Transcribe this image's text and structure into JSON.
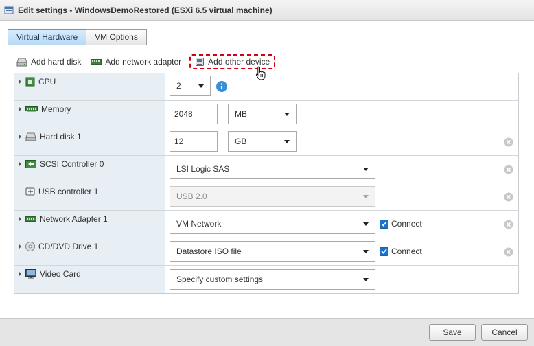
{
  "window": {
    "title": "Edit settings - WindowsDemoRestored (ESXi 6.5 virtual machine)"
  },
  "tabs": [
    {
      "label": "Virtual Hardware",
      "active": true
    },
    {
      "label": "VM Options",
      "active": false
    }
  ],
  "toolbar": {
    "add_hard_disk": "Add hard disk",
    "add_network_adapter": "Add network adapter",
    "add_other_device": "Add other device"
  },
  "hardware": {
    "cpu": {
      "label": "CPU",
      "value": "2"
    },
    "memory": {
      "label": "Memory",
      "value": "2048",
      "unit": "MB"
    },
    "hard_disk": {
      "label": "Hard disk 1",
      "value": "12",
      "unit": "GB"
    },
    "scsi": {
      "label": "SCSI Controller 0",
      "value": "LSI Logic SAS"
    },
    "usb": {
      "label": "USB controller 1",
      "value": "USB 2.0"
    },
    "network": {
      "label": "Network Adapter 1",
      "value": "VM Network",
      "connect_label": "Connect"
    },
    "cdrom": {
      "label": "CD/DVD Drive 1",
      "value": "Datastore ISO file",
      "connect_label": "Connect"
    },
    "video": {
      "label": "Video Card",
      "value": "Specify custom settings"
    }
  },
  "footer": {
    "save_label": "Save",
    "cancel_label": "Cancel"
  },
  "colors": {
    "accent": "#1a73c8",
    "highlight_border": "#d0021b",
    "label_column_bg": "#e7eef4"
  }
}
